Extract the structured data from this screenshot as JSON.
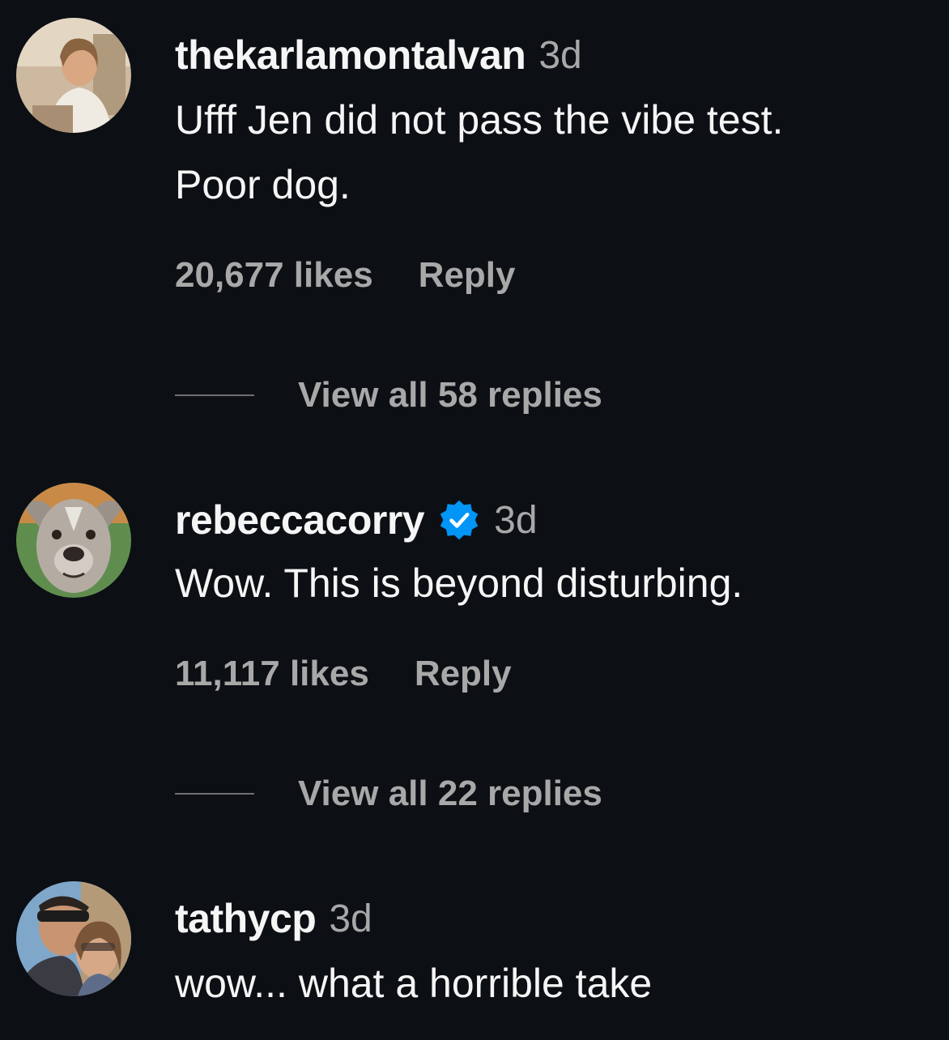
{
  "comments": [
    {
      "username": "thekarlamontalvan",
      "time": "3d",
      "verified": false,
      "text_lines": [
        "Ufff Jen did not pass the vibe test.",
        "Poor dog."
      ],
      "likes": "20,677 likes",
      "reply_label": "Reply",
      "view_replies": "View all 58 replies"
    },
    {
      "username": "rebeccacorry",
      "time": "3d",
      "verified": true,
      "text_lines": [
        "Wow. This is beyond disturbing."
      ],
      "likes": "11,117 likes",
      "reply_label": "Reply",
      "view_replies": "View all 22 replies"
    },
    {
      "username": "tathycp",
      "time": "3d",
      "verified": false,
      "text_lines": [
        "wow... what a horrible take"
      ]
    }
  ],
  "icons": {
    "verified": "verified-badge-icon"
  },
  "colors": {
    "background": "#0c0f14",
    "primary_text": "#f5f5f5",
    "secondary_text": "#a8a8a8",
    "verified_blue": "#0095f6"
  }
}
